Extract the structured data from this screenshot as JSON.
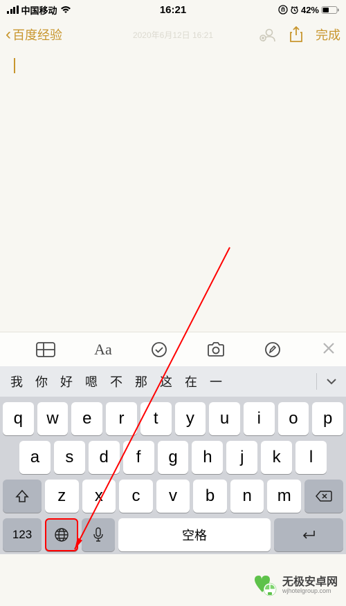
{
  "status": {
    "carrier": "中国移动",
    "time": "16:21",
    "battery_pct": "42%"
  },
  "nav": {
    "back_label": "百度经验",
    "faded_title": "2020年6月12日 16:21",
    "done_label": "完成"
  },
  "toolbar": {
    "aa": "Aa"
  },
  "suggestions": {
    "items": [
      "我",
      "你",
      "好",
      "嗯",
      "不",
      "那",
      "这",
      "在",
      "一"
    ]
  },
  "keyboard": {
    "row1": [
      "q",
      "w",
      "e",
      "r",
      "t",
      "y",
      "u",
      "i",
      "o",
      "p"
    ],
    "row2": [
      "a",
      "s",
      "d",
      "f",
      "g",
      "h",
      "j",
      "k",
      "l"
    ],
    "row3": [
      "z",
      "x",
      "c",
      "v",
      "b",
      "n",
      "m"
    ],
    "num_key": "123",
    "space_label": "空格",
    "return_label": ""
  },
  "watermark": {
    "title": "无极安卓网",
    "sub": "wjhotelgroup.com"
  }
}
